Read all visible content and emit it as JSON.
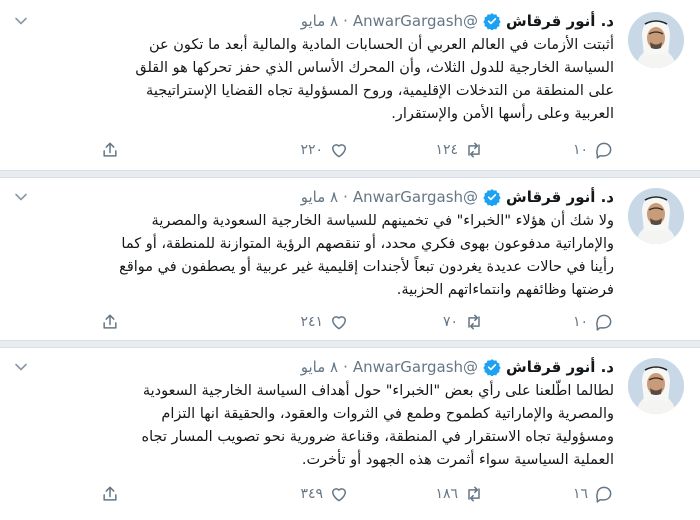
{
  "tweets": [
    {
      "name": "د. أنور قرقاش",
      "handle": "@AnwarGargash",
      "dot": "·",
      "date": "٨ مايو",
      "lines": [
        "أثبتت الأزمات في العالم العربي أن الحسابات المادية والمالية أبعد ما تكون عن",
        "السياسة الخارجية للدول الثلاث، وأن المحرك الأساس الذي حفز تحركها هو القلق",
        "على المنطقة من التدخلات الإقليمية، وروح المسؤولية تجاه القضايا الإستراتيجية",
        "العربية وعلى رأسها الأمن والإستقرار."
      ],
      "replies": "١٠",
      "retweets": "١٢٤",
      "likes": "٢٢٠"
    },
    {
      "name": "د. أنور قرقاش",
      "handle": "@AnwarGargash",
      "dot": "·",
      "date": "٨ مايو",
      "lines": [
        "ولا شك أن هؤلاء \"الخبراء\" في تخمينهم للسياسة الخارجية السعودية والمصرية",
        "والإماراتية مدفوعون بهوى فكري محدد، أو تنقصهم الرؤية المتوازنة للمنطقة، أو كما",
        "رأينا في حالات عديدة يغردون تبعاً لأجندات إقليمية غير عربية أو يصطفون في مواقع",
        "فرضتها وظائفهم وانتماءاتهم الحزبية."
      ],
      "replies": "١٠",
      "retweets": "٧٠",
      "likes": "٢٤١"
    },
    {
      "name": "د. أنور قرقاش",
      "handle": "@AnwarGargash",
      "dot": "·",
      "date": "٨ مايو",
      "lines": [
        "لطالما اطّلعنا على رأي بعض \"الخبراء\" حول أهداف السياسة الخارجية السعودية",
        "والمصرية والإماراتية كطموح وطمع في الثروات والعقود، والحقيقة انها التزام",
        "ومسؤولية تجاه الاستقرار في المنطقة، وقناعة ضرورية نحو تصويب المسار تجاه",
        "العملية السياسية سواء أثمرت هذه الجهود أو تأخرت."
      ],
      "replies": "١٦",
      "retweets": "١٨٦",
      "likes": "٣٤٩"
    }
  ],
  "icons": {
    "verified": "verified-badge-icon",
    "reply": "reply-bubble-icon",
    "retweet": "retweet-arrows-icon",
    "like": "heart-icon",
    "share": "share-upload-icon",
    "menu": "chevron-down-icon"
  },
  "colors": {
    "accent": "#1da1f2",
    "muted": "#657786",
    "text": "#14171a",
    "separator": "#e6ecf0"
  }
}
